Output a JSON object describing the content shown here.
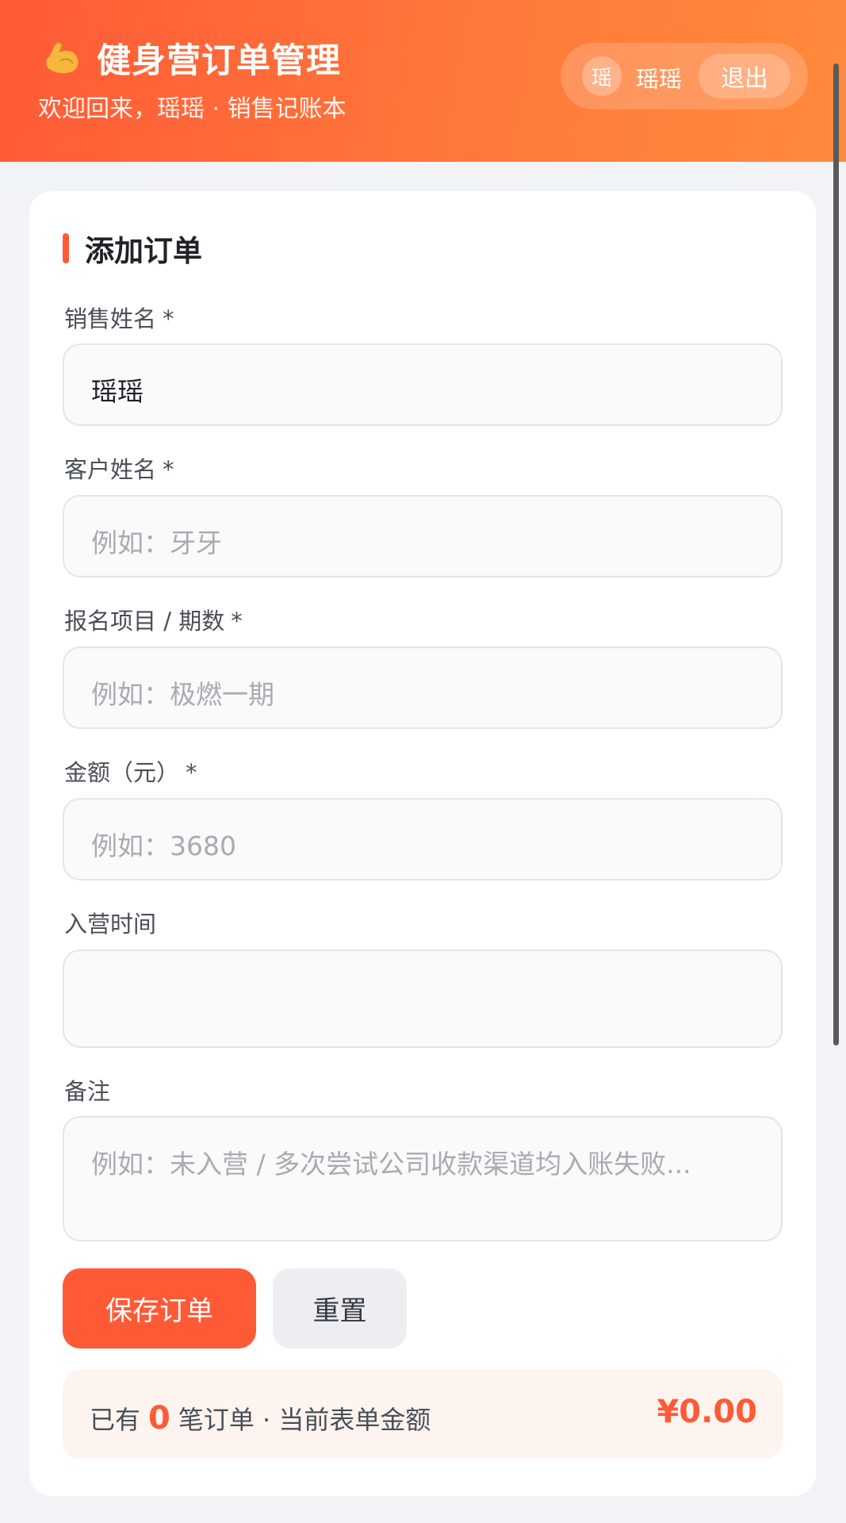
{
  "header": {
    "title": "健身营订单管理",
    "subtitle": "欢迎回来，瑶瑶 · 销售记账本",
    "avatar_text": "瑶",
    "user_name": "瑶瑶",
    "logout_label": "退出",
    "icon": "flexed-biceps-icon"
  },
  "form": {
    "section_title": "添加订单",
    "required_mark": "*",
    "fields": {
      "sales_name": {
        "label": "销售姓名",
        "value": "瑶瑶",
        "placeholder": ""
      },
      "customer_name": {
        "label": "客户姓名",
        "value": "",
        "placeholder": "例如：牙牙"
      },
      "program": {
        "label": "报名项目 / 期数",
        "value": "",
        "placeholder": "例如：极燃一期"
      },
      "amount": {
        "label": "金额（元）",
        "value": "",
        "placeholder": "例如：3680"
      },
      "start_date": {
        "label": "入营时间",
        "value": "",
        "placeholder": ""
      },
      "notes": {
        "label": "备注",
        "value": "",
        "placeholder": "例如：未入营 / 多次尝试公司收款渠道均入账失败..."
      }
    },
    "save_label": "保存订单",
    "reset_label": "重置"
  },
  "summary": {
    "prefix": "已有",
    "order_count": "0",
    "suffix": "笔订单 · 当前表单金额",
    "amount": "¥0.00"
  },
  "colors": {
    "accent": "#ff5a36",
    "header_gradient_end": "#ff8a3c",
    "summary_bg": "#fdf4ef"
  }
}
